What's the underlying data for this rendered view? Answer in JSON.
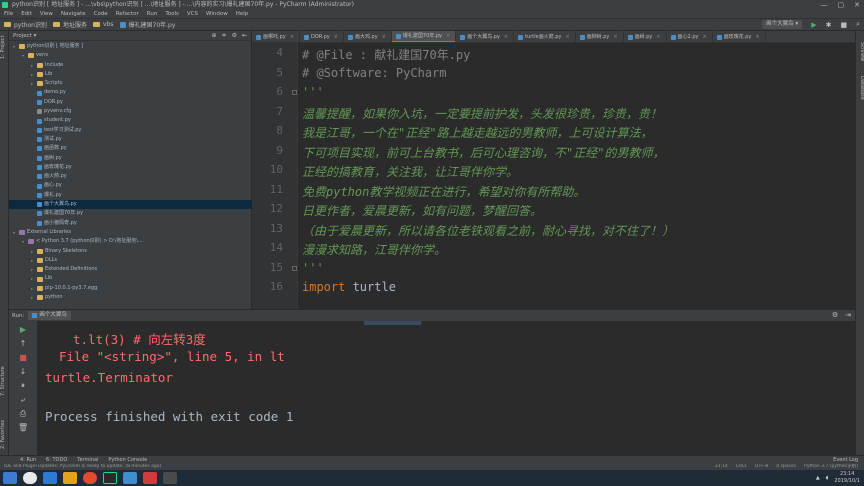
{
  "window": {
    "title": "python识别 [ 地址服务 ] - ...\\vbs\\python识别 [ ...\\地址服务 ] - ...\\内容的实习\\爆礼建国70年.py - PyCharm (Administrator)",
    "controls": [
      "—",
      "▢",
      "✕"
    ]
  },
  "menu": [
    "File",
    "Edit",
    "View",
    "Navigate",
    "Code",
    "Refactor",
    "Run",
    "Tools",
    "VCS",
    "Window",
    "Help"
  ],
  "navbar": {
    "crumbs": [
      "python识别",
      "地址服务",
      "vbs",
      "爆礼建国70年.py"
    ],
    "run_config": "画个大翼鸟 ▾"
  },
  "project": {
    "header": "Project ▾",
    "tree": [
      {
        "label": "python识别 [ 地址服务 ]",
        "kind": "folder",
        "indent": 0,
        "open": true
      },
      {
        "label": "venv",
        "kind": "folder",
        "indent": 1,
        "open": true
      },
      {
        "label": "Include",
        "kind": "folder",
        "indent": 2
      },
      {
        "label": "Lib",
        "kind": "folder",
        "indent": 2
      },
      {
        "label": "Scripts",
        "kind": "folder",
        "indent": 2
      },
      {
        "label": "demo.py",
        "kind": "py",
        "indent": 2
      },
      {
        "label": "DOR.py",
        "kind": "py",
        "indent": 2
      },
      {
        "label": "pyvenv.cfg",
        "kind": "txt",
        "indent": 2
      },
      {
        "label": "student.py",
        "kind": "py",
        "indent": 2
      },
      {
        "label": "test学习测试.py",
        "kind": "py",
        "indent": 2
      },
      {
        "label": "测试.py",
        "kind": "py",
        "indent": 2
      },
      {
        "label": "画函数.py",
        "kind": "py",
        "indent": 2
      },
      {
        "label": "画树.py",
        "kind": "py",
        "indent": 2
      },
      {
        "label": "画玫瑰花.py",
        "kind": "py",
        "indent": 2
      },
      {
        "label": "画火箭.py",
        "kind": "py",
        "indent": 2
      },
      {
        "label": "画心.py",
        "kind": "py",
        "indent": 2
      },
      {
        "label": "爆礼.py",
        "kind": "py",
        "indent": 2
      },
      {
        "label": "画个大翼鸟.py",
        "kind": "py",
        "indent": 2,
        "selected": true
      },
      {
        "label": "爆礼建国70年.py",
        "kind": "py",
        "indent": 2
      },
      {
        "label": "画小猪佩奇.py",
        "kind": "py",
        "indent": 2
      },
      {
        "label": "External Libraries",
        "kind": "lib",
        "indent": 0,
        "open": true
      },
      {
        "label": "< Python 3.7 (python识别) > D:\\地址服务\\...",
        "kind": "lib",
        "indent": 1,
        "open": true
      },
      {
        "label": "Binary Skeletons",
        "kind": "folder",
        "indent": 2
      },
      {
        "label": "DLLs",
        "kind": "folder",
        "indent": 2
      },
      {
        "label": "Extended Definitions",
        "kind": "folder",
        "indent": 2
      },
      {
        "label": "Lib",
        "kind": "folder",
        "indent": 2
      },
      {
        "label": "pip-10.0.1-py3.7.egg",
        "kind": "folder",
        "indent": 2
      },
      {
        "label": "python",
        "kind": "folder",
        "indent": 2
      }
    ]
  },
  "tabs": [
    {
      "label": "画哪吒.py"
    },
    {
      "label": "DOR.py"
    },
    {
      "label": "画大鸡.py"
    },
    {
      "label": "爆礼建国70年.py",
      "active": true
    },
    {
      "label": "画个大翼鸟.py"
    },
    {
      "label": "turtle画火箭.py"
    },
    {
      "label": "画柳树.py"
    },
    {
      "label": "画树.py"
    },
    {
      "label": "画心2.py"
    },
    {
      "label": "画玫瑰花.py"
    }
  ],
  "editor": {
    "lines": [
      {
        "n": "4",
        "parts": [
          {
            "t": "# @File : 献礼建国70年.py",
            "c": "comment"
          }
        ]
      },
      {
        "n": "5",
        "parts": [
          {
            "t": "# @Software: PyCharm",
            "c": "comment"
          }
        ]
      },
      {
        "n": "6",
        "parts": [
          {
            "t": "'''",
            "c": "doc"
          }
        ]
      },
      {
        "n": "7",
        "parts": [
          {
            "t": "温馨提醒，如果你入坑，一定要提前护发，头发很珍贵，珍贵，贵！",
            "c": "doc"
          }
        ]
      },
      {
        "n": "8",
        "parts": [
          {
            "t": "我是江哥，一个在\"正经\"路上越走越远的男教师，上可设计算法，",
            "c": "doc"
          }
        ]
      },
      {
        "n": "9",
        "parts": [
          {
            "t": "下可项目实现，前可上台教书，后可心理咨询，不\"正经\"的男教师，",
            "c": "doc"
          }
        ]
      },
      {
        "n": "10",
        "parts": [
          {
            "t": "正经的搞教育，关注我，让江哥伴你学。",
            "c": "doc"
          }
        ]
      },
      {
        "n": "11",
        "parts": [
          {
            "t": "免费python教学视频正在进行，希望对你有所帮助。",
            "c": "doc"
          }
        ]
      },
      {
        "n": "12",
        "parts": [
          {
            "t": "日更作者，爱晨更新，如有问题，梦醒回答。",
            "c": "doc"
          }
        ]
      },
      {
        "n": "13",
        "parts": [
          {
            "t": "（由于爱晨更新，所以请各位老铁观看之前，耐心寻找，对不住了！）",
            "c": "doc"
          }
        ]
      },
      {
        "n": "14",
        "parts": [
          {
            "t": "漫漫求知路，江哥伴你学。",
            "c": "doc"
          }
        ]
      },
      {
        "n": "15",
        "parts": [
          {
            "t": "'''",
            "c": "doc"
          }
        ]
      },
      {
        "n": "16",
        "parts": [
          {
            "t": "import",
            "c": "kw"
          },
          {
            "t": " turtle",
            "c": "id"
          }
        ]
      }
    ]
  },
  "run": {
    "label": "Run:",
    "tab": "画个大翼鸟",
    "output": [
      {
        "text": "t.lt(3)  # 向左转3度",
        "style": "err-indent"
      },
      {
        "text": "File \"<string>\", line 5, in lt",
        "style": "err-indent2"
      },
      {
        "text": "turtle.Terminator",
        "style": "err"
      },
      {
        "text": "",
        "style": "norm"
      },
      {
        "text": "Process finished with exit code 1",
        "style": "norm"
      }
    ]
  },
  "bottom_tabs": [
    "4: Run",
    "6: TODO",
    "Terminal",
    "Python Console"
  ],
  "event_log": "Event Log",
  "status": {
    "message": "IDE and Plugin Updates: PyCharm is ready to update. (8 minutes ago)",
    "right": [
      "23:14",
      "CRLF",
      "UTF-8",
      "4 spaces",
      "Python 3.7 (python识别)"
    ]
  },
  "taskbar": {
    "time": "23:14",
    "date": "2019/10/1"
  }
}
